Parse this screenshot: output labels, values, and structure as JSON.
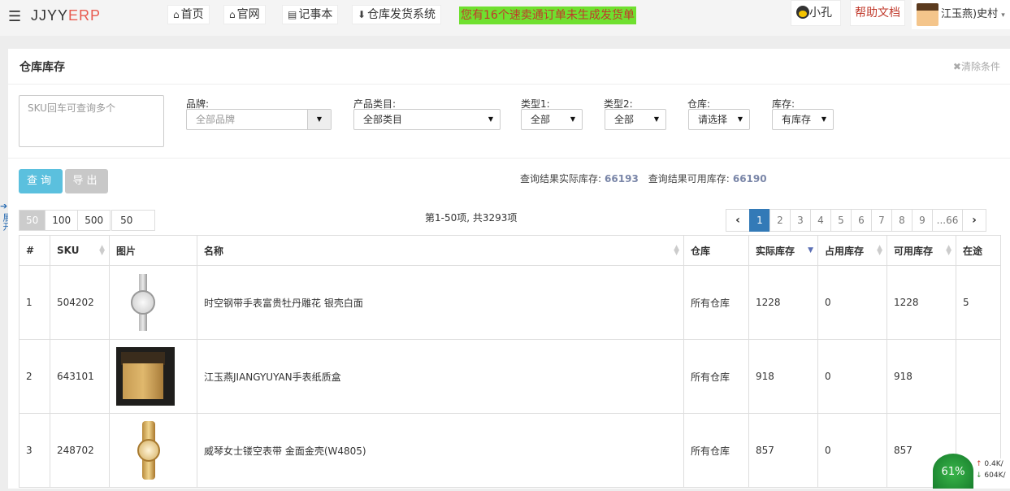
{
  "topbar": {
    "logo_main": "JJYY",
    "logo_accent": "ERP",
    "nav": [
      {
        "icon": "home-icon",
        "glyph": "⌂",
        "label": "首页"
      },
      {
        "icon": "home-icon",
        "glyph": "⌂",
        "label": "官网"
      },
      {
        "icon": "book-icon",
        "glyph": "▤",
        "label": "记事本"
      },
      {
        "icon": "download-icon",
        "glyph": "⬇",
        "label": "仓库发货系统"
      }
    ],
    "alert": "您有16个速卖通订单未生成发货单",
    "qq_label": "小孔",
    "help_label": "帮助文档",
    "user_name": "江玉燕)史村"
  },
  "panel": {
    "title": "仓库库存",
    "clear_label": "清除条件",
    "sku_placeholder": "SKU回车可查询多个",
    "filters": {
      "brand": {
        "label": "品牌:",
        "value": "全部品牌"
      },
      "category": {
        "label": "产品类目:",
        "value": "全部类目"
      },
      "type1": {
        "label": "类型1:",
        "value": "全部"
      },
      "type2": {
        "label": "类型2:",
        "value": "全部"
      },
      "warehouse": {
        "label": "仓库:",
        "value": "请选择"
      },
      "stock": {
        "label": "库存:",
        "value": "有库存"
      }
    },
    "query_button": "查询",
    "export_button": "导出",
    "summary_actual_label": "查询结果实际库存:",
    "summary_actual_value": "66193",
    "summary_available_label": "查询结果可用库存:",
    "summary_available_value": "66190",
    "page_sizes": [
      "50",
      "100",
      "500"
    ],
    "page_size_input": "50",
    "count_text": "第1-50项, 共3293项",
    "pages": [
      "1",
      "2",
      "3",
      "4",
      "5",
      "6",
      "7",
      "8",
      "9",
      "...66"
    ],
    "side_tab": "展开"
  },
  "table": {
    "headers": [
      "#",
      "SKU",
      "图片",
      "名称",
      "仓库",
      "实际库存",
      "占用库存",
      "可用库存",
      "在途"
    ],
    "rows": [
      {
        "no": "1",
        "sku": "504202",
        "name": "时空钢带手表富贵牡丹雕花 银壳白面",
        "warehouse": "所有仓库",
        "actual": "1228",
        "occupied": "0",
        "available": "1228",
        "transit": "5"
      },
      {
        "no": "2",
        "sku": "643101",
        "name": "江玉燕JIANGYUYAN手表纸质盒",
        "warehouse": "所有仓库",
        "actual": "918",
        "occupied": "0",
        "available": "918",
        "transit": ""
      },
      {
        "no": "3",
        "sku": "248702",
        "name": "威琴女士镂空表带 金面金壳(W4805)",
        "warehouse": "所有仓库",
        "actual": "857",
        "occupied": "0",
        "available": "857",
        "transit": ""
      }
    ]
  },
  "tray": {
    "percent": "61%",
    "up": "0.4K/",
    "down": "604K/"
  }
}
